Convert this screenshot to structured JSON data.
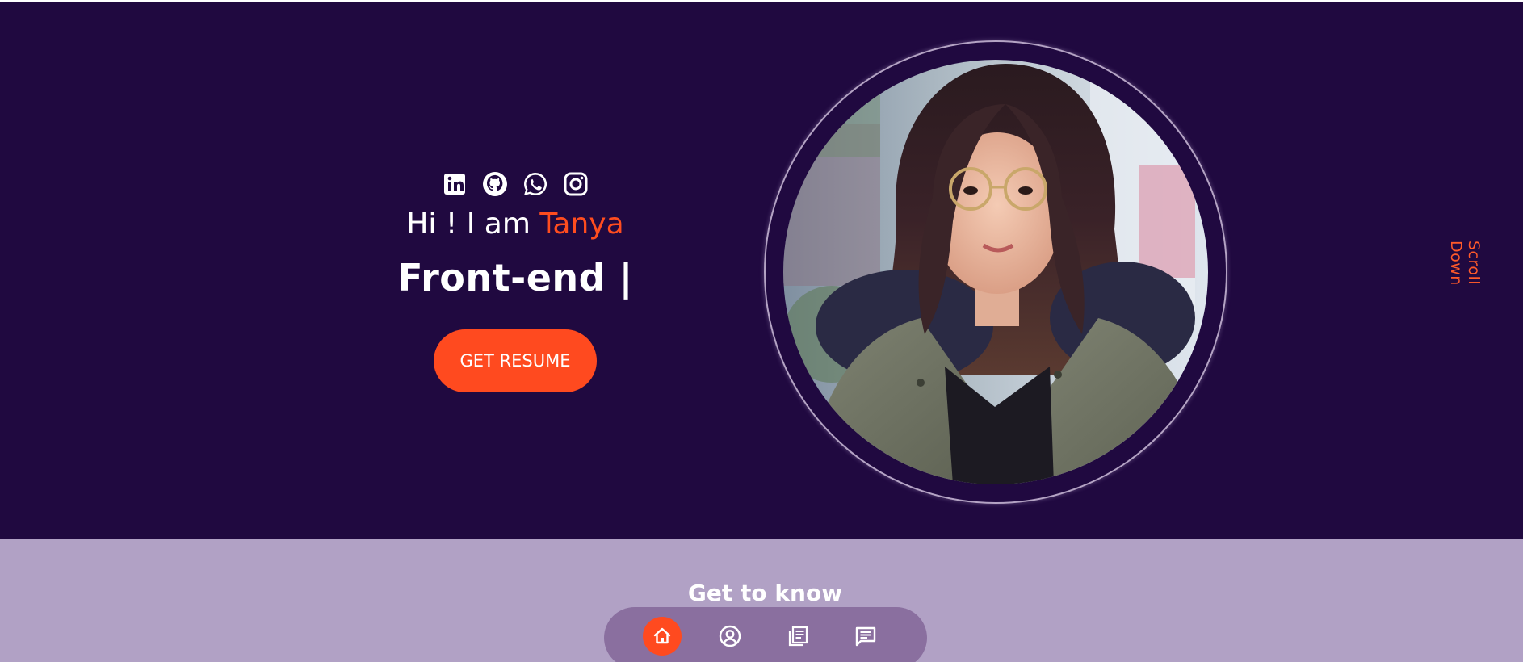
{
  "hero": {
    "greeting_prefix": "Hi ! I am ",
    "name": "Tanya",
    "role_text": "Front-end |",
    "resume_button": "GET RESUME",
    "scroll_hint": "Scroll Down",
    "socials": [
      "linkedin-icon",
      "github-icon",
      "whatsapp-icon",
      "instagram-icon"
    ]
  },
  "about": {
    "title": "Get to know"
  },
  "nav": {
    "items": [
      "home-icon",
      "user-icon",
      "portfolio-icon",
      "message-icon"
    ],
    "active": "home-icon"
  },
  "colors": {
    "hero_background": "#200940",
    "accent": "#ff4a1f",
    "about_background": "#b1a1c5",
    "nav_background": "#8a6f9f"
  }
}
